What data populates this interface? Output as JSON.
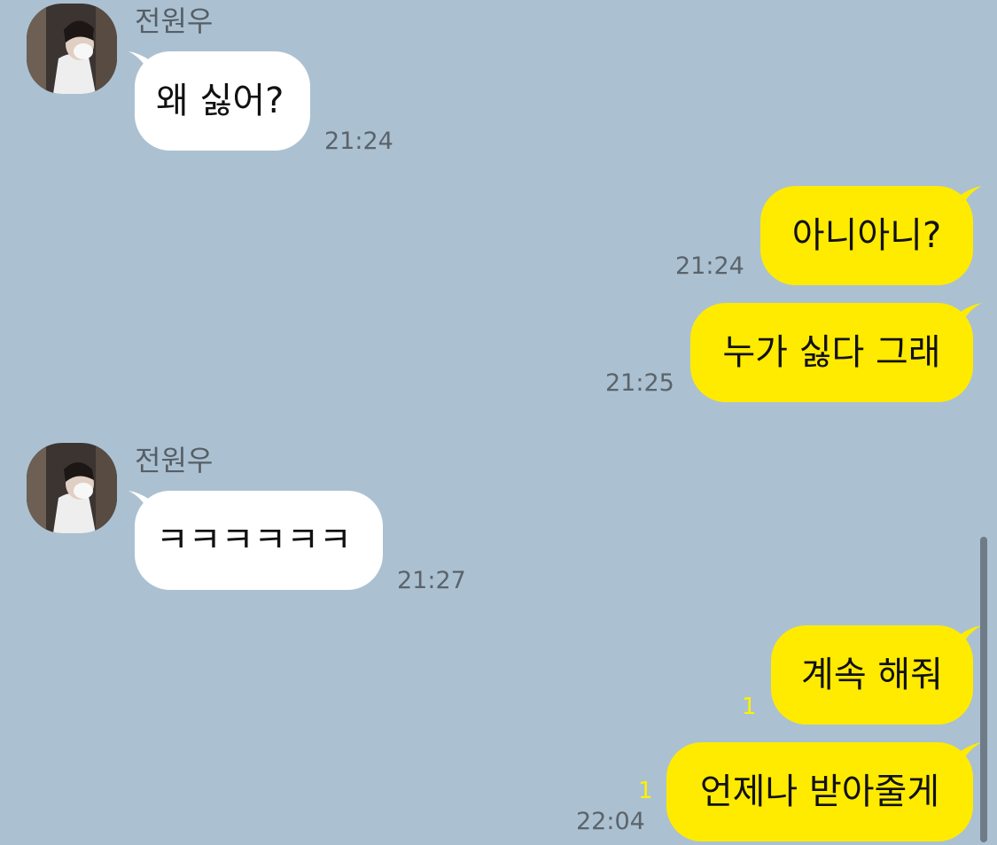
{
  "chat": {
    "messages": [
      {
        "sender": "전원우",
        "direction": "incoming",
        "text": "왜 싫어?",
        "time": "21:24"
      },
      {
        "direction": "outgoing",
        "text": "아니아니?",
        "time": "21:24"
      },
      {
        "direction": "outgoing",
        "text": "누가 싫다 그래",
        "time": "21:25"
      },
      {
        "sender": "전원우",
        "direction": "incoming",
        "text": "ㅋㅋㅋㅋㅋㅋ",
        "time": "21:27"
      },
      {
        "direction": "outgoing",
        "text": "계속 해줘",
        "unread": "1"
      },
      {
        "direction": "outgoing",
        "text": "언제나 받아줄게",
        "unread": "1",
        "time": "22:04"
      }
    ]
  },
  "colors": {
    "background": "#abc1d1",
    "incoming_bubble": "#ffffff",
    "outgoing_bubble": "#ffeb00",
    "unread_count": "#fff100",
    "time_text": "#5b636b"
  },
  "icons": {
    "avatar": "profile-photo"
  }
}
